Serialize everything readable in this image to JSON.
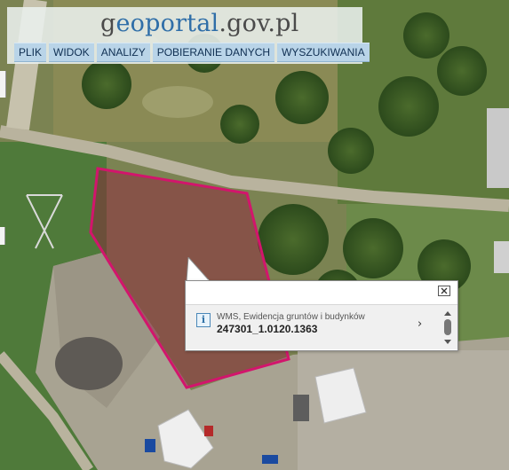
{
  "header": {
    "logo_g": "g",
    "logo_e": "e",
    "logo_portal": "oportal",
    "logo_domain": ".gov.pl"
  },
  "menu": {
    "items": [
      "PLIK",
      "WIDOK",
      "ANALIZY",
      "POBIERANIE DANYCH",
      "WYSZUKIWANIA"
    ]
  },
  "popup": {
    "layer_name": "WMS, Ewidencja gruntów i budynków",
    "parcel_id": "247301_1.0120.1363",
    "info_glyph": "i",
    "next_glyph": "›"
  },
  "colors": {
    "parcel_outline": "#d2156c",
    "menu_bg": "#b9d4e8",
    "logo_blue": "#2f6ea8"
  },
  "icons": [
    "info-icon",
    "close-icon",
    "chevron-right-icon",
    "scroll-knob-icon"
  ]
}
